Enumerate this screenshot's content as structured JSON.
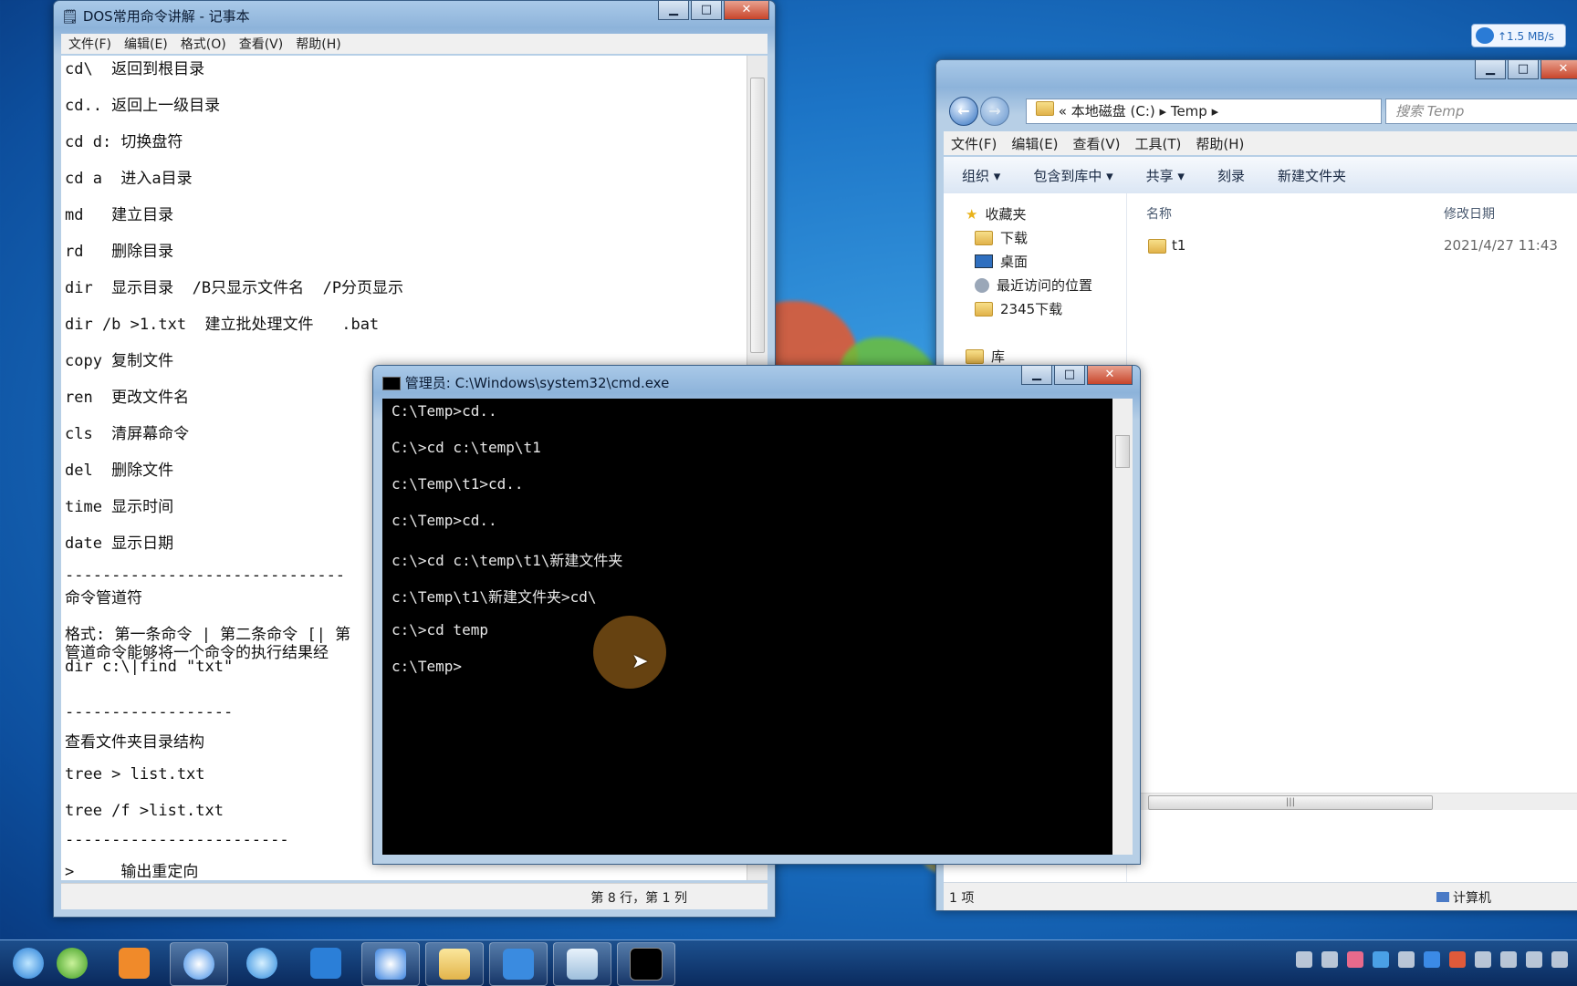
{
  "notepad": {
    "title": "DOS常用命令讲解 - 记事本",
    "menu": [
      "文件(F)",
      "编辑(E)",
      "格式(O)",
      "查看(V)",
      "帮助(H)"
    ],
    "lines": [
      "cd\\  返回到根目录",
      "cd.. 返回上一级目录",
      "cd d: 切换盘符",
      "cd a  进入a目录",
      "md   建立目录",
      "rd   删除目录",
      "dir  显示目录  /B只显示文件名  /P分页显示",
      "dir /b >1.txt  建立批处理文件   .bat",
      "copy 复制文件",
      "ren  更改文件名",
      "cls  清屏幕命令",
      "del  删除文件",
      "time 显示时间",
      "date 显示日期",
      "------------------------------",
      "命令管道符",
      "格式: 第一条命令 | 第二条命令 [| 第",
      "管道命令能够将一个命令的执行结果经",
      "dir c:\\|find \"txt\"",
      "------------------",
      "查看文件夹目录结构",
      "tree > list.txt",
      "tree /f >list.txt",
      "------------------------",
      ">     输出重定向"
    ],
    "status": "第 8 行，第 1 列"
  },
  "explorer": {
    "address": [
      "«",
      "本地磁盘 (C:)",
      "▸",
      "Temp",
      "▸"
    ],
    "search_placeholder": "搜索 Temp",
    "menu": [
      "文件(F)",
      "编辑(E)",
      "查看(V)",
      "工具(T)",
      "帮助(H)"
    ],
    "toolbar": [
      "组织 ▾",
      "包含到库中 ▾",
      "共享 ▾",
      "刻录",
      "新建文件夹"
    ],
    "tree": [
      "收藏夹",
      "下载",
      "桌面",
      "最近访问的位置",
      "2345下载",
      "库"
    ],
    "columns": [
      "名称",
      "修改日期"
    ],
    "files": [
      {
        "name": "t1",
        "date": "2021/4/27 11:43"
      }
    ],
    "status_count": "1 项",
    "status_location": "计算机"
  },
  "cmd": {
    "title": "管理员: C:\\Windows\\system32\\cmd.exe",
    "lines": [
      "C:\\Temp>cd..",
      "C:\\>cd c:\\temp\\t1",
      "c:\\Temp\\t1>cd..",
      "c:\\Temp>cd..",
      "c:\\>cd c:\\temp\\t1\\新建文件夹",
      "c:\\Temp\\t1\\新建文件夹>cd\\",
      "c:\\>cd temp",
      "c:\\Temp>"
    ]
  },
  "net_speed": "↑1.5 MB/s",
  "colors": {
    "accent": "#1c74c6",
    "cmd_bg": "#000000",
    "close": "#c8452b"
  }
}
